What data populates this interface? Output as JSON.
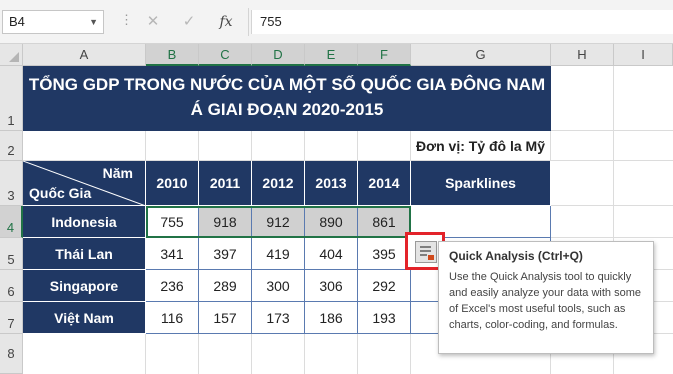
{
  "formula_bar": {
    "name_box": "B4",
    "separator": "⋮",
    "cancel_icon": "✕",
    "enter_icon": "✓",
    "function_label": "fx",
    "value": "755"
  },
  "columns": [
    "A",
    "B",
    "C",
    "D",
    "E",
    "F",
    "G",
    "H",
    "I"
  ],
  "rows": [
    "1",
    "2",
    "3",
    "4",
    "5",
    "6",
    "7",
    "8"
  ],
  "sheet": {
    "title": "TỔNG GDP TRONG NƯỚC CỦA MỘT SỐ QUỐC GIA ĐÔNG NAM Á GIAI ĐOẠN 2020-2015",
    "unit": "Đơn vị: Tỷ đô la Mỹ",
    "header_year": "Năm",
    "header_country": "Quốc Gia",
    "years": [
      "2010",
      "2011",
      "2012",
      "2013",
      "2014"
    ],
    "sparklines_label": "Sparklines",
    "data": [
      {
        "country": "Indonesia",
        "values": [
          "755",
          "918",
          "912",
          "890",
          "861"
        ]
      },
      {
        "country": "Thái Lan",
        "values": [
          "341",
          "397",
          "419",
          "404",
          "395"
        ]
      },
      {
        "country": "Singapore",
        "values": [
          "236",
          "289",
          "300",
          "306",
          "292"
        ]
      },
      {
        "country": "Việt Nam",
        "values": [
          "116",
          "157",
          "173",
          "186",
          "193"
        ]
      }
    ]
  },
  "quick_analysis": {
    "button_icon": "quick-analysis-icon",
    "tooltip_title": "Quick Analysis (Ctrl+Q)",
    "tooltip_body": "Use the Quick Analysis tool to quickly and easily analyze your data with some of Excel's most useful tools, such as charts, color-coding, and formulas."
  },
  "colors": {
    "header_navy": "#203864",
    "selection_green": "#217346",
    "highlight_red": "#e3232a"
  }
}
